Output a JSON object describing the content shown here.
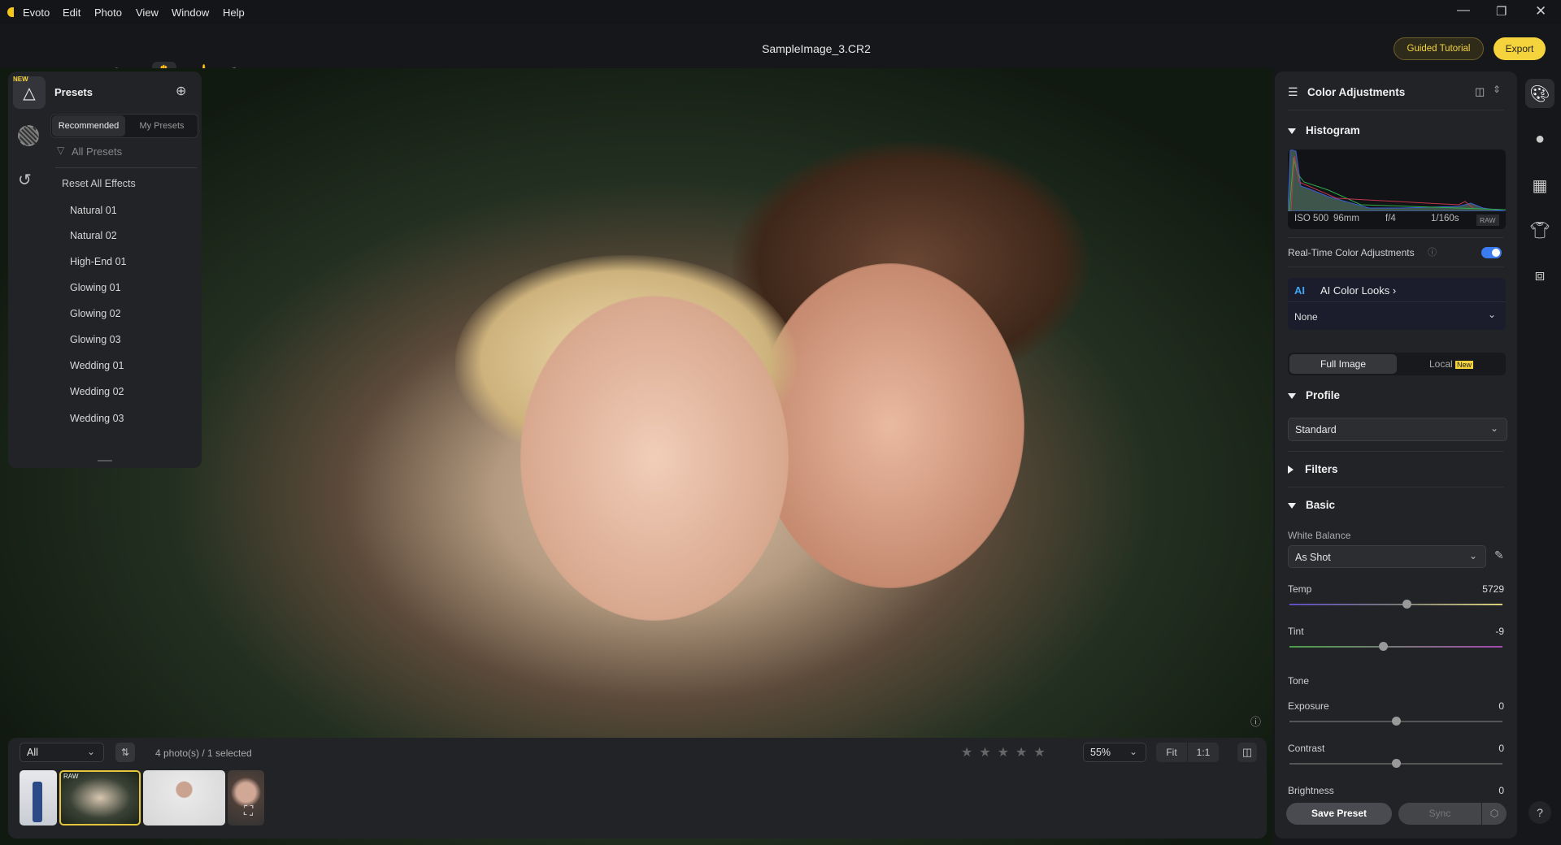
{
  "app": {
    "name": "Evoto",
    "menu": [
      "Edit",
      "Photo",
      "View",
      "Window",
      "Help"
    ]
  },
  "window": {
    "title": "SampleImage_3.CR2",
    "guided_tutorial": "Guided Tutorial",
    "export": "Export",
    "accent": "#f5d33c"
  },
  "toolbar": {
    "icons": [
      "home-icon",
      "add-icon",
      "undo-icon",
      "hand-icon",
      "brush-icon",
      "bandage-icon"
    ]
  },
  "left_panel": {
    "badge": "NEW",
    "title": "Presets",
    "tabs": [
      "Recommended",
      "My Presets"
    ],
    "active_tab": "Recommended",
    "filter": "All Presets",
    "reset": "Reset All Effects",
    "presets": [
      "Natural 01",
      "Natural 02",
      "High-End 01",
      "Glowing 01",
      "Glowing 02",
      "Glowing 03",
      "Wedding 01",
      "Wedding 02",
      "Wedding 03"
    ]
  },
  "right_panel": {
    "title": "Color Adjustments",
    "histogram": {
      "title": "Histogram",
      "iso": "ISO 500",
      "focal": "96mm",
      "aperture": "f/4",
      "shutter": "1/160s",
      "raw": "RAW"
    },
    "realtime": {
      "label": "Real-Time Color Adjustments",
      "enabled": true
    },
    "ai_looks": {
      "icon": "AI",
      "label": "AI Color Looks",
      "value": "None"
    },
    "scope_tabs": {
      "full": "Full Image",
      "local": "Local",
      "local_badge": "New",
      "active": "Full Image"
    },
    "profile": {
      "title": "Profile",
      "value": "Standard"
    },
    "filters": {
      "title": "Filters"
    },
    "basic": {
      "title": "Basic",
      "white_balance_label": "White Balance",
      "white_balance": "As Shot",
      "temp": {
        "label": "Temp",
        "value": "5729",
        "fraction": 0.55
      },
      "tint": {
        "label": "Tint",
        "value": "-9",
        "fraction": 0.44
      },
      "tone_label": "Tone",
      "exposure": {
        "label": "Exposure",
        "value": "0",
        "fraction": 0.5
      },
      "contrast": {
        "label": "Contrast",
        "value": "0",
        "fraction": 0.5
      },
      "brightness": {
        "label": "Brightness",
        "value": "0"
      }
    },
    "save_preset": "Save Preset",
    "sync": "Sync"
  },
  "filmstrip": {
    "filter": "All",
    "count": "4 photo(s) / 1 selected",
    "rating": 0,
    "zoom": "55%",
    "fit": "Fit",
    "one_to_one": "1:1",
    "raw_badge": "RAW"
  },
  "help": "?"
}
